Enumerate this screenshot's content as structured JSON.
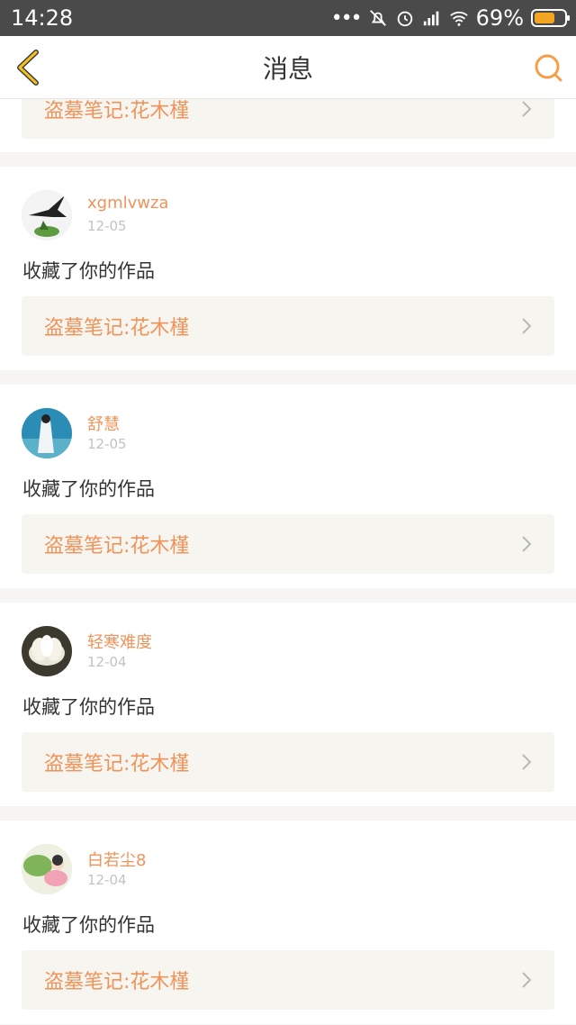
{
  "status_bar": {
    "time": "14:28",
    "battery": "69%",
    "battery_level": 0.69
  },
  "header": {
    "title": "消息",
    "back_icon": "chevron-left-icon",
    "search_icon": "search-icon",
    "accent": "#f4a623"
  },
  "feed": {
    "partial_item": {
      "work_title": "盗墓笔记:花木槿"
    },
    "items": [
      {
        "username": "xgmlvwza",
        "date": "12-05",
        "action": "收藏了你的作品",
        "work_title": "盗墓笔记:花木槿"
      },
      {
        "username": "舒慧",
        "date": "12-05",
        "action": "收藏了你的作品",
        "work_title": "盗墓笔记:花木槿"
      },
      {
        "username": "轻寒难度",
        "date": "12-04",
        "action": "收藏了你的作品",
        "work_title": "盗墓笔记:花木槿"
      },
      {
        "username": "白若尘8",
        "date": "12-04",
        "action": "收藏了你的作品",
        "work_title": "盗墓笔记:花木槿"
      }
    ]
  },
  "colors": {
    "username": "#f0935a",
    "date": "#c3c3c3",
    "card_link_bg": "#f6f5ef"
  }
}
